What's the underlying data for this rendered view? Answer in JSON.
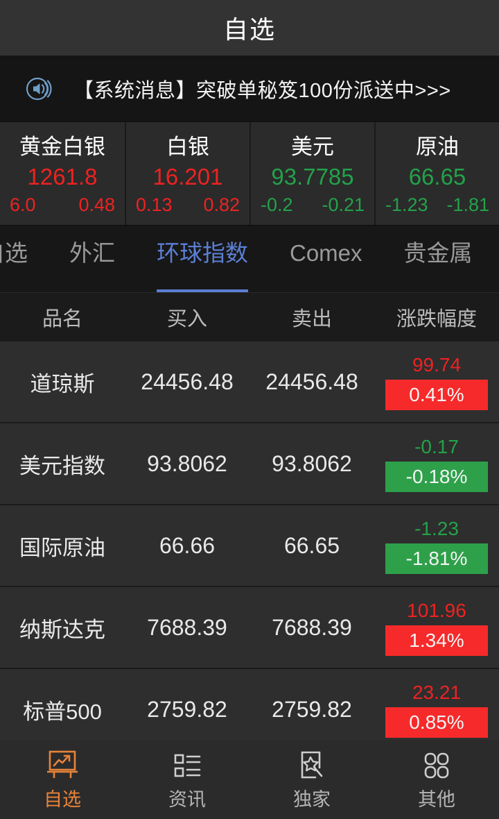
{
  "header": {
    "title": "自选"
  },
  "notice": {
    "icon": "speaker-icon",
    "text": "【系统消息】突破单秘笈100份派送中>>>"
  },
  "colors": {
    "up_red": "#f62a2a",
    "down_green": "#2ea04a",
    "accent_orange": "#e8833a",
    "tab_active_blue": "#5b7fd4",
    "notice_icon_blue": "#6f9fc8"
  },
  "ticker": [
    {
      "name": "黄金白银",
      "price": "1261.8",
      "change": "6.0",
      "change_pct": "0.48",
      "direction": "up"
    },
    {
      "name": "白银",
      "price": "16.201",
      "change": "0.13",
      "change_pct": "0.82",
      "direction": "up"
    },
    {
      "name": "美元",
      "price": "93.7785",
      "change": "-0.2",
      "change_pct": "-0.21",
      "direction": "down"
    },
    {
      "name": "原油",
      "price": "66.65",
      "change": "-1.23",
      "change_pct": "-1.81",
      "direction": "down"
    }
  ],
  "tabs": [
    {
      "label": "自选",
      "active": false
    },
    {
      "label": "外汇",
      "active": false
    },
    {
      "label": "环球指数",
      "active": true
    },
    {
      "label": "Comex",
      "active": false
    },
    {
      "label": "贵金属",
      "active": false
    }
  ],
  "table": {
    "columns": [
      "品名",
      "买入",
      "卖出",
      "涨跌幅度"
    ],
    "rows": [
      {
        "name": "道琼斯",
        "buy": "24456.48",
        "sell": "24456.48",
        "change": "99.74",
        "change_pct": "0.41%",
        "direction": "up"
      },
      {
        "name": "美元指数",
        "buy": "93.8062",
        "sell": "93.8062",
        "change": "-0.17",
        "change_pct": "-0.18%",
        "direction": "down"
      },
      {
        "name": "国际原油",
        "buy": "66.66",
        "sell": "66.65",
        "change": "-1.23",
        "change_pct": "-1.81%",
        "direction": "down"
      },
      {
        "name": "纳斯达克",
        "buy": "7688.39",
        "sell": "7688.39",
        "change": "101.96",
        "change_pct": "1.34%",
        "direction": "up"
      },
      {
        "name": "标普500",
        "buy": "2759.82",
        "sell": "2759.82",
        "change": "23.21",
        "change_pct": "0.85%",
        "direction": "up"
      }
    ]
  },
  "bottom_nav": [
    {
      "label": "自选",
      "icon": "chart-board-icon",
      "active": true
    },
    {
      "label": "资讯",
      "icon": "list-icon",
      "active": false
    },
    {
      "label": "独家",
      "icon": "star-frame-icon",
      "active": false
    },
    {
      "label": "其他",
      "icon": "grid-icon",
      "active": false
    }
  ]
}
